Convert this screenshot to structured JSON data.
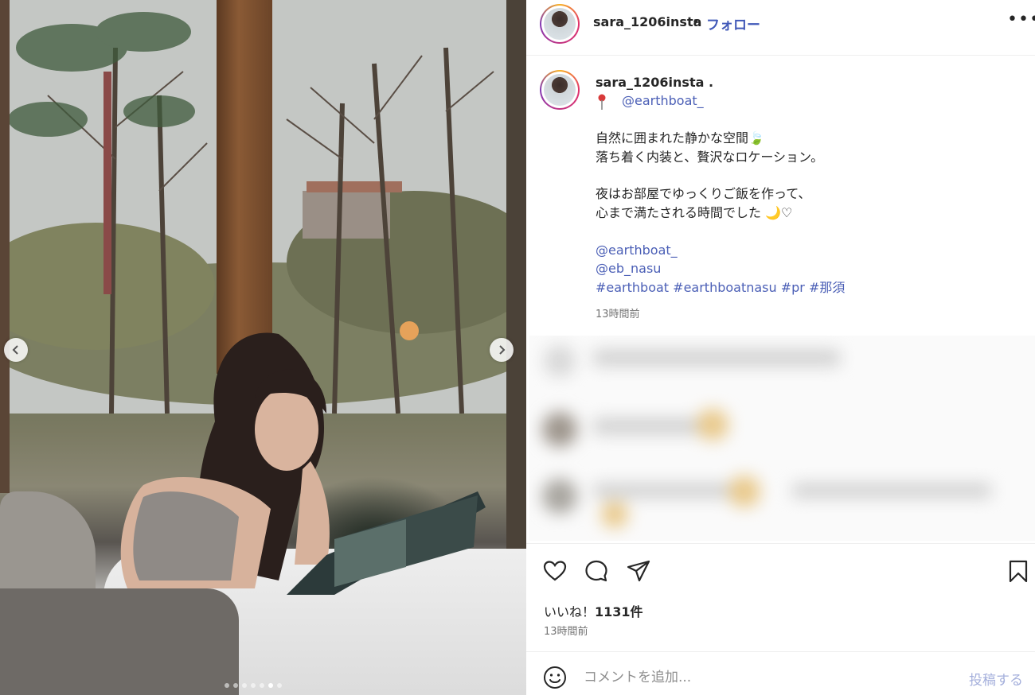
{
  "header": {
    "username": "sara_1206insta",
    "separator": "•",
    "follow_label": "フォロー",
    "more_label": "•••"
  },
  "caption": {
    "username": "sara_1206insta .",
    "location_mention": "@earthboat_",
    "lines": [
      "自然に囲まれた静かな空間🍃",
      "落ち着く内装と、贅沢なロケーション。",
      "夜はお部屋でゆっくりご飯を作って、",
      "心まで満たされる時間でした 🌙♡"
    ],
    "tags": [
      "@earthboat_",
      "@eb_nasu",
      "#earthboat #earthboatnasu #pr #那須"
    ],
    "time": "13時間前"
  },
  "actions": {
    "likes_prefix": "いいね！",
    "likes_count": "1131件",
    "time": "13時間前"
  },
  "comment_bar": {
    "placeholder": "コメントを追加...",
    "post_label": "投稿する"
  },
  "carousel": {
    "slide_count": 7,
    "active_index": 5
  },
  "icons": {
    "like": "heart-icon",
    "comment": "comment-icon",
    "share": "send-icon",
    "save": "bookmark-icon",
    "emoji": "smiley-icon",
    "prev": "chevron-left-icon",
    "next": "chevron-right-icon",
    "location": "pin-icon"
  },
  "colors": {
    "link": "#4b5fb6",
    "follow": "#4058b8",
    "post_disabled": "#a5b0dc",
    "muted": "#737373"
  }
}
